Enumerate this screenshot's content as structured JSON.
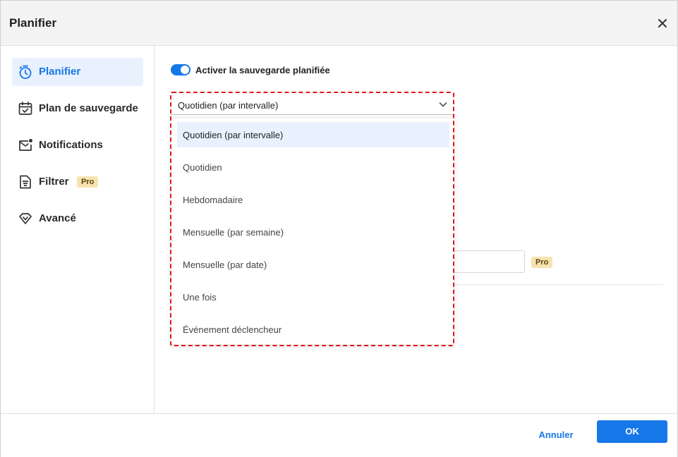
{
  "window": {
    "title": "Planifier"
  },
  "sidebar": {
    "items": [
      {
        "label": "Planifier",
        "icon": "timer-icon",
        "active": true
      },
      {
        "label": "Plan de sauvegarde",
        "icon": "calendar-check-icon",
        "active": false
      },
      {
        "label": "Notifications",
        "icon": "mail-notification-icon",
        "active": false
      },
      {
        "label": "Filtrer",
        "icon": "filter-document-icon",
        "active": false,
        "badge": "Pro"
      },
      {
        "label": "Avancé",
        "icon": "diamond-icon",
        "active": false
      }
    ]
  },
  "main": {
    "toggle_label": "Activer la sauvegarde planifiée",
    "toggle_on": true,
    "frequency_select": {
      "value": "Quotidien (par intervalle)",
      "options": [
        "Quotidien (par intervalle)",
        "Quotidien",
        "Hebdomadaire",
        "Mensuelle (par semaine)",
        "Mensuelle (par date)",
        "Une fois",
        "Événement déclencheur"
      ]
    },
    "pro_badge": "Pro"
  },
  "footer": {
    "cancel_label": "Annuler",
    "ok_label": "OK"
  },
  "colors": {
    "accent": "#1677e8",
    "highlight": "#e0161d",
    "pro_badge_bg": "#f6e3b0"
  }
}
